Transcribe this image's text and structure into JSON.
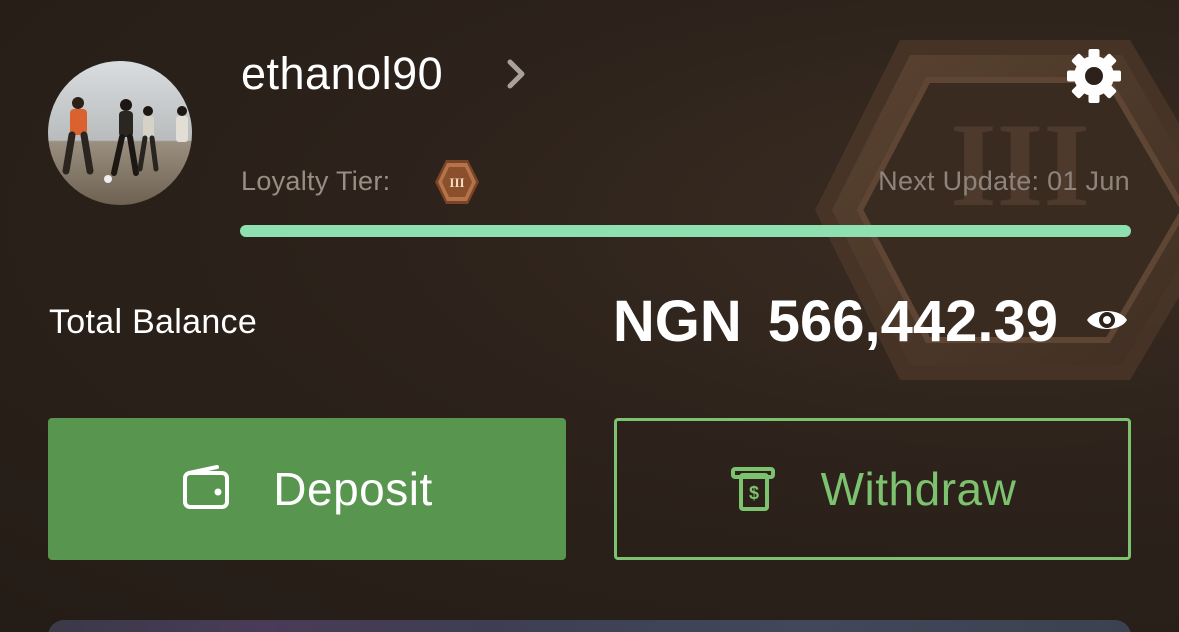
{
  "profile": {
    "username": "ethanol90",
    "avatar": "beach-players-photo",
    "settings_icon": "gear-icon",
    "chevron_icon": "chevron-right-icon"
  },
  "loyalty": {
    "label": "Loyalty Tier:",
    "tier": "III",
    "next_update": "Next Update: 01 Jun",
    "progress": 1.0,
    "progress_color": "#8fe0b0",
    "badge_color": "#a7693f"
  },
  "balance": {
    "label": "Total Balance",
    "currency": "NGN",
    "amount": "566,442.39",
    "toggle_icon": "eye-icon"
  },
  "actions": {
    "deposit": {
      "label": "Deposit",
      "icon": "wallet-icon",
      "color": "#58954f"
    },
    "withdraw": {
      "label": "Withdraw",
      "icon": "cash-withdraw-icon",
      "color": "#7cc26f"
    }
  },
  "background": {
    "badge_tier": "III"
  }
}
